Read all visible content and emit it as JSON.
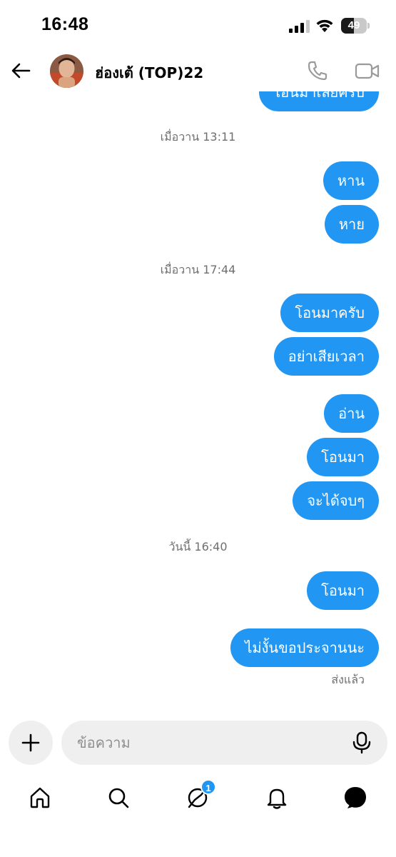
{
  "status_bar": {
    "time": "16:48",
    "battery_level": "49"
  },
  "header": {
    "contact_name": "ฮ่องเต้ (TOP)22"
  },
  "messages": [
    {
      "type": "bubble",
      "text": "โอนมาเลยครับ"
    },
    {
      "type": "timestamp",
      "text": "เมื่อวาน 13:11"
    },
    {
      "type": "bubble",
      "text": "หาน"
    },
    {
      "type": "bubble",
      "text": "หาย"
    },
    {
      "type": "timestamp",
      "text": "เมื่อวาน 17:44"
    },
    {
      "type": "bubble",
      "text": "โอนมาครับ"
    },
    {
      "type": "bubble",
      "text": "อย่าเสียเวลา"
    },
    {
      "type": "bubble",
      "text": "อ่าน"
    },
    {
      "type": "bubble",
      "text": "โอนมา"
    },
    {
      "type": "bubble",
      "text": "จะได้จบๆ"
    },
    {
      "type": "timestamp",
      "text": "วันนี้ 16:40"
    },
    {
      "type": "bubble",
      "text": "โอนมา"
    },
    {
      "type": "bubble",
      "text": "ไม่งั้นขอประจานนะ"
    }
  ],
  "seen_status": "ส่งแล้ว",
  "composer": {
    "placeholder": "ข้อความ"
  },
  "nav": {
    "messages_badge": "1"
  },
  "colors": {
    "bubble": "#2196f3",
    "badge": "#2196f3",
    "timestamp": "#6f6f6f"
  },
  "icons": [
    "back-arrow-icon",
    "phone-icon",
    "video-camera-icon",
    "plus-icon",
    "microphone-icon",
    "home-icon",
    "search-icon",
    "threads-icon",
    "bell-icon",
    "chat-icon"
  ]
}
